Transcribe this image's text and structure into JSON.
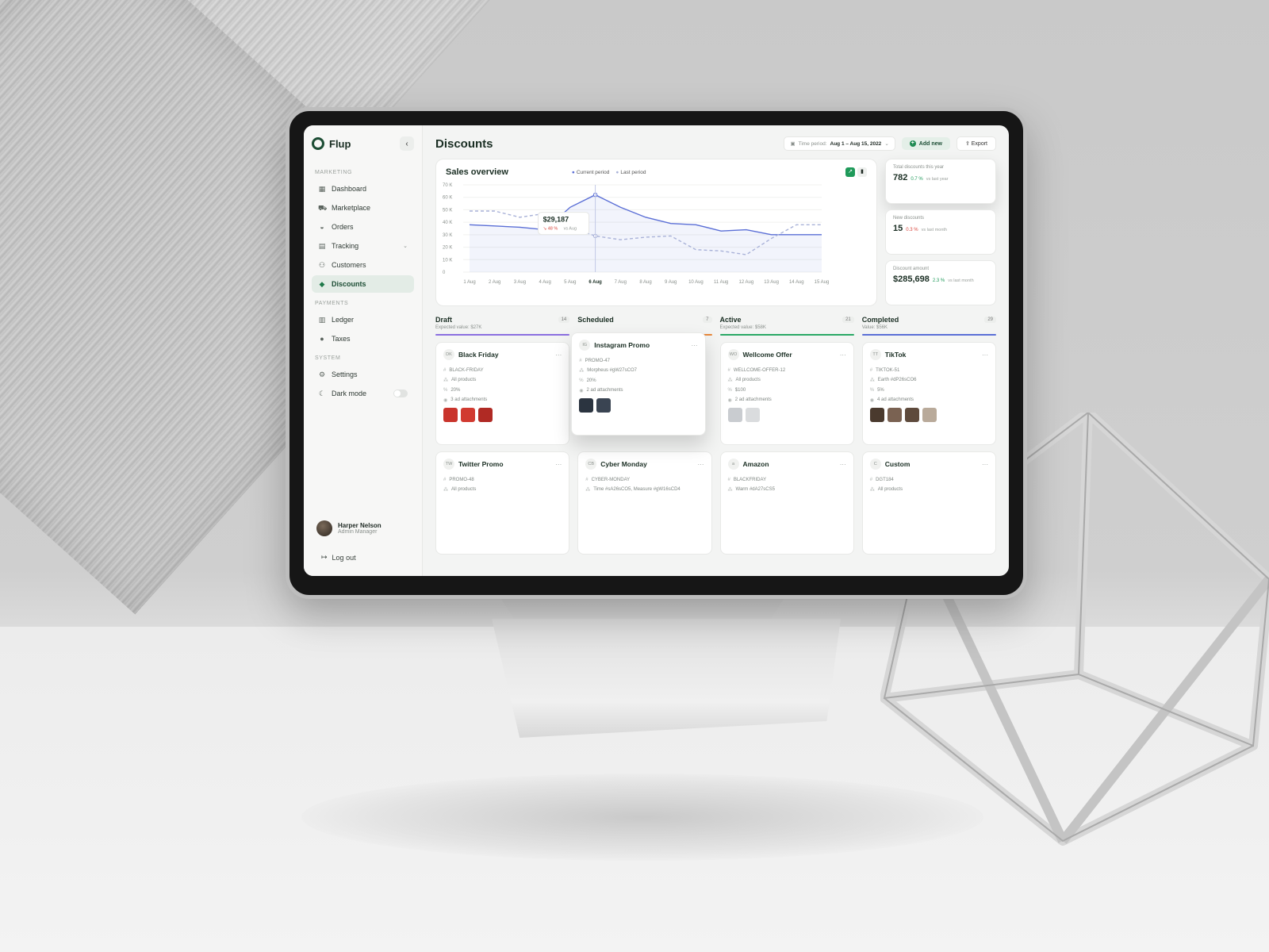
{
  "app": {
    "name": "Flup",
    "page_title": "Discounts"
  },
  "sidebar": {
    "sections": [
      {
        "label": "MARKETING",
        "items": [
          {
            "label": "Dashboard",
            "icon": "dashboard-icon"
          },
          {
            "label": "Marketplace",
            "icon": "cart-icon"
          },
          {
            "label": "Orders",
            "icon": "basket-icon"
          },
          {
            "label": "Tracking",
            "icon": "map-icon"
          },
          {
            "label": "Customers",
            "icon": "users-icon"
          },
          {
            "label": "Discounts",
            "icon": "tag-icon",
            "active": true
          }
        ]
      },
      {
        "label": "PAYMENTS",
        "items": [
          {
            "label": "Ledger",
            "icon": "ledger-icon"
          },
          {
            "label": "Taxes",
            "icon": "taxes-icon"
          }
        ]
      },
      {
        "label": "SYSTEM",
        "items": [
          {
            "label": "Settings",
            "icon": "gear-icon"
          },
          {
            "label": "Dark mode",
            "icon": "moon-icon"
          }
        ]
      }
    ],
    "user": {
      "name": "Harper Nelson",
      "role": "Admin Manager"
    },
    "logout_label": "Log out"
  },
  "toolbar": {
    "time_period_label": "Time period:",
    "time_period_value": "Aug 1 – Aug 15, 2022",
    "add_label": "Add new",
    "export_label": "Export"
  },
  "sales_overview": {
    "title": "Sales overview",
    "legend_current": "Current period",
    "legend_last": "Last period",
    "tooltip_value": "$29,187",
    "tooltip_delta": "48 %",
    "tooltip_vs": "vs Aug"
  },
  "chart_data": {
    "type": "line",
    "x": [
      "1 Aug",
      "2 Aug",
      "3 Aug",
      "4 Aug",
      "5 Aug",
      "6 Aug",
      "7 Aug",
      "8 Aug",
      "9 Aug",
      "10 Aug",
      "11 Aug",
      "12 Aug",
      "13 Aug",
      "14 Aug",
      "15 Aug"
    ],
    "y_ticks": [
      "70 K",
      "60 K",
      "50 K",
      "40 K",
      "30 K",
      "20 K",
      "10 K",
      "0"
    ],
    "ylim": [
      0,
      70000
    ],
    "highlight_x": "6 Aug",
    "series": [
      {
        "name": "Current period",
        "color": "#5b6fd6",
        "style": "solid",
        "values": [
          38000,
          37000,
          36000,
          34000,
          52000,
          62000,
          52000,
          44000,
          39000,
          38000,
          33000,
          34000,
          30000,
          30000,
          30000
        ]
      },
      {
        "name": "Last period",
        "color": "#a9b2d8",
        "style": "dashed",
        "values": [
          49000,
          49000,
          44000,
          47000,
          36000,
          29000,
          26000,
          28000,
          29000,
          18000,
          17000,
          14000,
          27000,
          38000,
          38000
        ]
      }
    ]
  },
  "stats": [
    {
      "label": "Total discounts this year",
      "value": "782",
      "delta": "0.7 %",
      "direction": "up",
      "vs": "vs last year"
    },
    {
      "label": "New discounts",
      "value": "15",
      "delta": "0.3 %",
      "direction": "down",
      "vs": "vs last month"
    },
    {
      "label": "Discount amount",
      "value": "$285,698",
      "delta": "2.3 %",
      "direction": "up",
      "vs": "vs last month"
    }
  ],
  "board": [
    {
      "title": "Draft",
      "count": "14",
      "sub": "Expected value: $27K",
      "color": "#8b6fe0",
      "cards": [
        {
          "initials": "DK",
          "title": "Black Friday",
          "code": "BLACK-FRIDAY",
          "target": "All products",
          "amount": "20%",
          "attachments": "3 ad attachments",
          "thumbs": [
            "#c9342c",
            "#d13a30",
            "#b02a24"
          ]
        },
        {
          "initials": "TW",
          "title": "Twitter Promo",
          "code": "PROMO-48",
          "target": "All products",
          "amount": "",
          "attachments": "",
          "thumbs": []
        }
      ]
    },
    {
      "title": "Scheduled",
      "count": "7",
      "sub": "",
      "color": "#e8883a",
      "cards": [
        {
          "initials": "IG",
          "title": "Instagram Promo",
          "code": "PROMO-47",
          "target": "Morpheus #gW27sCO7",
          "amount": "20%",
          "attachments": "2 ad attachments",
          "thumbs": [
            "#2b3440",
            "#3a4452"
          ]
        },
        {
          "initials": "CB",
          "title": "Cyber Monday",
          "code": "CYBER-MONDAY",
          "target": "Time #sA26sCO5, Measure #gW16sCD4",
          "amount": "",
          "attachments": "",
          "thumbs": []
        }
      ]
    },
    {
      "title": "Active",
      "count": "21",
      "sub": "Expected value: $58K",
      "color": "#2aa866",
      "cards": [
        {
          "initials": "WO",
          "title": "Wellcome Offer",
          "code": "WELLCOME-OFFER-12",
          "target": "All products",
          "amount": "$100",
          "attachments": "2 ad attachments",
          "thumbs": [
            "#c9ccd0",
            "#dadcde"
          ]
        },
        {
          "initials": "a",
          "title": "Amazon",
          "code": "BLACKFRIDAY",
          "target": "Warm #dA27sCS5",
          "amount": "",
          "attachments": "",
          "thumbs": []
        }
      ]
    },
    {
      "title": "Completed",
      "count": "29",
      "sub": "Value: $56K",
      "color": "#5b6fd6",
      "cards": [
        {
          "initials": "TT",
          "title": "TikTok",
          "code": "TIKTOK-51",
          "target": "Earth #dP26sCO6",
          "amount": "5%",
          "attachments": "4 ad attachments",
          "thumbs": [
            "#4a3a2e",
            "#7a6252",
            "#5e4a3c",
            "#b9aa9a"
          ]
        },
        {
          "initials": "C",
          "title": "Custom",
          "code": "DGT184",
          "target": "All products",
          "amount": "",
          "attachments": "",
          "thumbs": []
        }
      ]
    }
  ]
}
